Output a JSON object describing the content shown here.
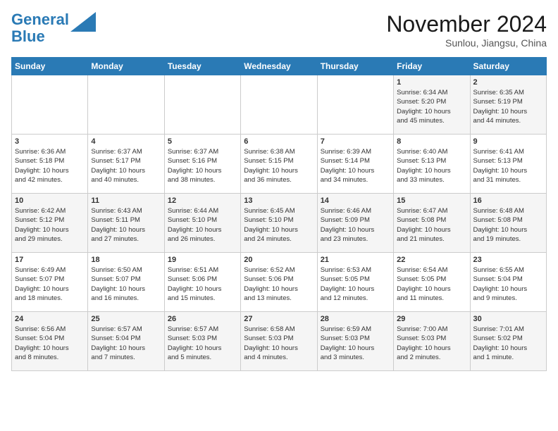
{
  "header": {
    "logo_line1": "General",
    "logo_line2": "Blue",
    "month": "November 2024",
    "location": "Sunlou, Jiangsu, China"
  },
  "weekdays": [
    "Sunday",
    "Monday",
    "Tuesday",
    "Wednesday",
    "Thursday",
    "Friday",
    "Saturday"
  ],
  "weeks": [
    [
      {
        "day": "",
        "content": ""
      },
      {
        "day": "",
        "content": ""
      },
      {
        "day": "",
        "content": ""
      },
      {
        "day": "",
        "content": ""
      },
      {
        "day": "",
        "content": ""
      },
      {
        "day": "1",
        "content": "Sunrise: 6:34 AM\nSunset: 5:20 PM\nDaylight: 10 hours\nand 45 minutes."
      },
      {
        "day": "2",
        "content": "Sunrise: 6:35 AM\nSunset: 5:19 PM\nDaylight: 10 hours\nand 44 minutes."
      }
    ],
    [
      {
        "day": "3",
        "content": "Sunrise: 6:36 AM\nSunset: 5:18 PM\nDaylight: 10 hours\nand 42 minutes."
      },
      {
        "day": "4",
        "content": "Sunrise: 6:37 AM\nSunset: 5:17 PM\nDaylight: 10 hours\nand 40 minutes."
      },
      {
        "day": "5",
        "content": "Sunrise: 6:37 AM\nSunset: 5:16 PM\nDaylight: 10 hours\nand 38 minutes."
      },
      {
        "day": "6",
        "content": "Sunrise: 6:38 AM\nSunset: 5:15 PM\nDaylight: 10 hours\nand 36 minutes."
      },
      {
        "day": "7",
        "content": "Sunrise: 6:39 AM\nSunset: 5:14 PM\nDaylight: 10 hours\nand 34 minutes."
      },
      {
        "day": "8",
        "content": "Sunrise: 6:40 AM\nSunset: 5:13 PM\nDaylight: 10 hours\nand 33 minutes."
      },
      {
        "day": "9",
        "content": "Sunrise: 6:41 AM\nSunset: 5:13 PM\nDaylight: 10 hours\nand 31 minutes."
      }
    ],
    [
      {
        "day": "10",
        "content": "Sunrise: 6:42 AM\nSunset: 5:12 PM\nDaylight: 10 hours\nand 29 minutes."
      },
      {
        "day": "11",
        "content": "Sunrise: 6:43 AM\nSunset: 5:11 PM\nDaylight: 10 hours\nand 27 minutes."
      },
      {
        "day": "12",
        "content": "Sunrise: 6:44 AM\nSunset: 5:10 PM\nDaylight: 10 hours\nand 26 minutes."
      },
      {
        "day": "13",
        "content": "Sunrise: 6:45 AM\nSunset: 5:10 PM\nDaylight: 10 hours\nand 24 minutes."
      },
      {
        "day": "14",
        "content": "Sunrise: 6:46 AM\nSunset: 5:09 PM\nDaylight: 10 hours\nand 23 minutes."
      },
      {
        "day": "15",
        "content": "Sunrise: 6:47 AM\nSunset: 5:08 PM\nDaylight: 10 hours\nand 21 minutes."
      },
      {
        "day": "16",
        "content": "Sunrise: 6:48 AM\nSunset: 5:08 PM\nDaylight: 10 hours\nand 19 minutes."
      }
    ],
    [
      {
        "day": "17",
        "content": "Sunrise: 6:49 AM\nSunset: 5:07 PM\nDaylight: 10 hours\nand 18 minutes."
      },
      {
        "day": "18",
        "content": "Sunrise: 6:50 AM\nSunset: 5:07 PM\nDaylight: 10 hours\nand 16 minutes."
      },
      {
        "day": "19",
        "content": "Sunrise: 6:51 AM\nSunset: 5:06 PM\nDaylight: 10 hours\nand 15 minutes."
      },
      {
        "day": "20",
        "content": "Sunrise: 6:52 AM\nSunset: 5:06 PM\nDaylight: 10 hours\nand 13 minutes."
      },
      {
        "day": "21",
        "content": "Sunrise: 6:53 AM\nSunset: 5:05 PM\nDaylight: 10 hours\nand 12 minutes."
      },
      {
        "day": "22",
        "content": "Sunrise: 6:54 AM\nSunset: 5:05 PM\nDaylight: 10 hours\nand 11 minutes."
      },
      {
        "day": "23",
        "content": "Sunrise: 6:55 AM\nSunset: 5:04 PM\nDaylight: 10 hours\nand 9 minutes."
      }
    ],
    [
      {
        "day": "24",
        "content": "Sunrise: 6:56 AM\nSunset: 5:04 PM\nDaylight: 10 hours\nand 8 minutes."
      },
      {
        "day": "25",
        "content": "Sunrise: 6:57 AM\nSunset: 5:04 PM\nDaylight: 10 hours\nand 7 minutes."
      },
      {
        "day": "26",
        "content": "Sunrise: 6:57 AM\nSunset: 5:03 PM\nDaylight: 10 hours\nand 5 minutes."
      },
      {
        "day": "27",
        "content": "Sunrise: 6:58 AM\nSunset: 5:03 PM\nDaylight: 10 hours\nand 4 minutes."
      },
      {
        "day": "28",
        "content": "Sunrise: 6:59 AM\nSunset: 5:03 PM\nDaylight: 10 hours\nand 3 minutes."
      },
      {
        "day": "29",
        "content": "Sunrise: 7:00 AM\nSunset: 5:03 PM\nDaylight: 10 hours\nand 2 minutes."
      },
      {
        "day": "30",
        "content": "Sunrise: 7:01 AM\nSunset: 5:02 PM\nDaylight: 10 hours\nand 1 minute."
      }
    ]
  ]
}
